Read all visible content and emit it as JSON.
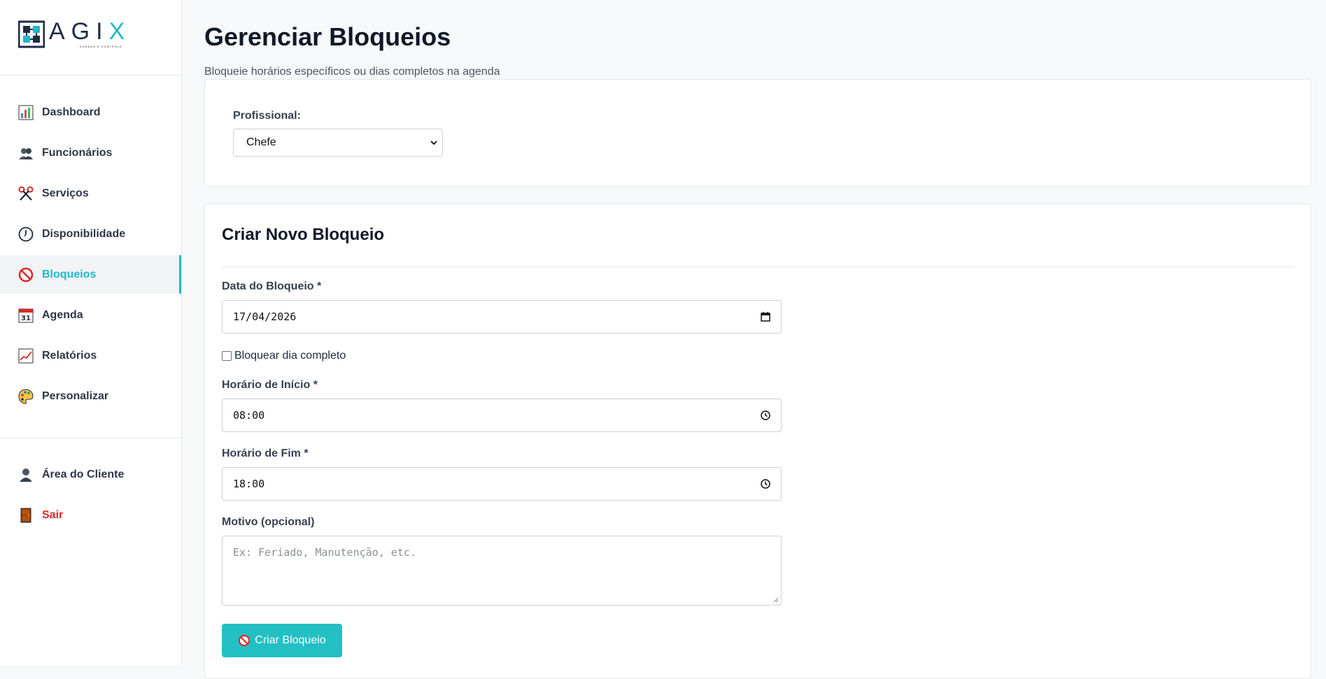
{
  "brand": {
    "name_main": "AGI",
    "name_x": "X",
    "tagline": "AGENDA E CONTROLE"
  },
  "sidebar": {
    "items": [
      {
        "label": "Dashboard",
        "icon": "bar-chart-icon"
      },
      {
        "label": "Funcionários",
        "icon": "people-icon"
      },
      {
        "label": "Serviços",
        "icon": "scissors-icon"
      },
      {
        "label": "Disponibilidade",
        "icon": "clock-icon"
      },
      {
        "label": "Bloqueios",
        "icon": "prohibited-icon",
        "active": true
      },
      {
        "label": "Agenda",
        "icon": "calendar-icon",
        "calendar_day": "31"
      },
      {
        "label": "Relatórios",
        "icon": "line-chart-icon"
      },
      {
        "label": "Personalizar",
        "icon": "palette-icon"
      }
    ],
    "bottom": [
      {
        "label": "Área do Cliente",
        "icon": "user-icon"
      },
      {
        "label": "Sair",
        "icon": "door-icon"
      }
    ]
  },
  "page": {
    "title": "Gerenciar Bloqueios",
    "subtitle": "Bloqueie horários específicos ou dias completos na agenda"
  },
  "professional": {
    "label": "Profissional:",
    "selected": "Chefe"
  },
  "form": {
    "title": "Criar Novo Bloqueio",
    "date_label": "Data do Bloqueio *",
    "date_value": "17/04/2026",
    "full_day_label": "Bloquear dia completo",
    "full_day_checked": false,
    "start_label": "Horário de Início *",
    "start_value": "08:00",
    "end_label": "Horário de Fim *",
    "end_value": "18:00",
    "reason_label": "Motivo (opcional)",
    "reason_placeholder": "Ex: Feriado, Manutenção, etc.",
    "submit_label": "Criar Bloqueio"
  },
  "colors": {
    "accent": "#22b8c8",
    "button": "#22bfc4",
    "logout": "#dc2626",
    "title": "#111827"
  }
}
